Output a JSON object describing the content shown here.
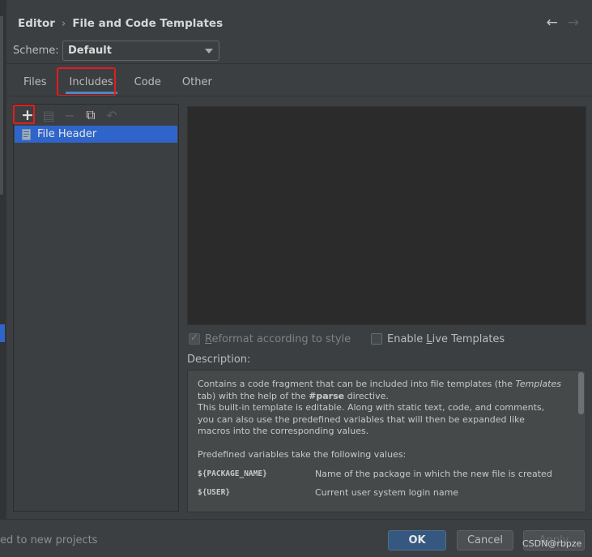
{
  "breadcrumb": {
    "parent": "Editor",
    "separator": "›",
    "current": "File and Code Templates"
  },
  "nav": {
    "back": "←",
    "forward": "→"
  },
  "scheme": {
    "label": "Scheme:",
    "value": "Default"
  },
  "tabs": [
    {
      "label": "Files"
    },
    {
      "label": "Includes"
    },
    {
      "label": "Code"
    },
    {
      "label": "Other"
    }
  ],
  "toolbar": {
    "add": "+",
    "copy_icon": "▤",
    "remove": "−",
    "duplicate_icon": "⧉",
    "reset": "↶"
  },
  "templates_list": [
    {
      "label": "File Header"
    }
  ],
  "options": {
    "reformat_label_pre": "",
    "reformat_label_u": "R",
    "reformat_label_post": "eformat according to style",
    "live_pre": "Enable ",
    "live_u": "L",
    "live_post": "ive Templates"
  },
  "description": {
    "label": "Description:",
    "line1_a": "Contains a code fragment that can be included into file templates (the ",
    "line1_em": "Templates",
    "line2_a": "tab) with the help of the ",
    "line2_b": "#parse",
    "line2_c": " directive.",
    "line3": "This built-in template is editable. Along with static text, code, and comments,",
    "line4": "you can also use the predefined variables that will then be expanded like",
    "line5": "macros into the corresponding values.",
    "line6": "Predefined variables take the following values:",
    "variables": [
      {
        "name": "${PACKAGE_NAME}",
        "desc": "Name of the package in which the new file is created"
      },
      {
        "name": "${USER}",
        "desc": "Current user system login name"
      }
    ]
  },
  "footer": {
    "left_text": "ed to new projects",
    "ok": "OK",
    "cancel": "Cancel",
    "apply": "Apply",
    "watermark": "CSDN@rbpze"
  }
}
